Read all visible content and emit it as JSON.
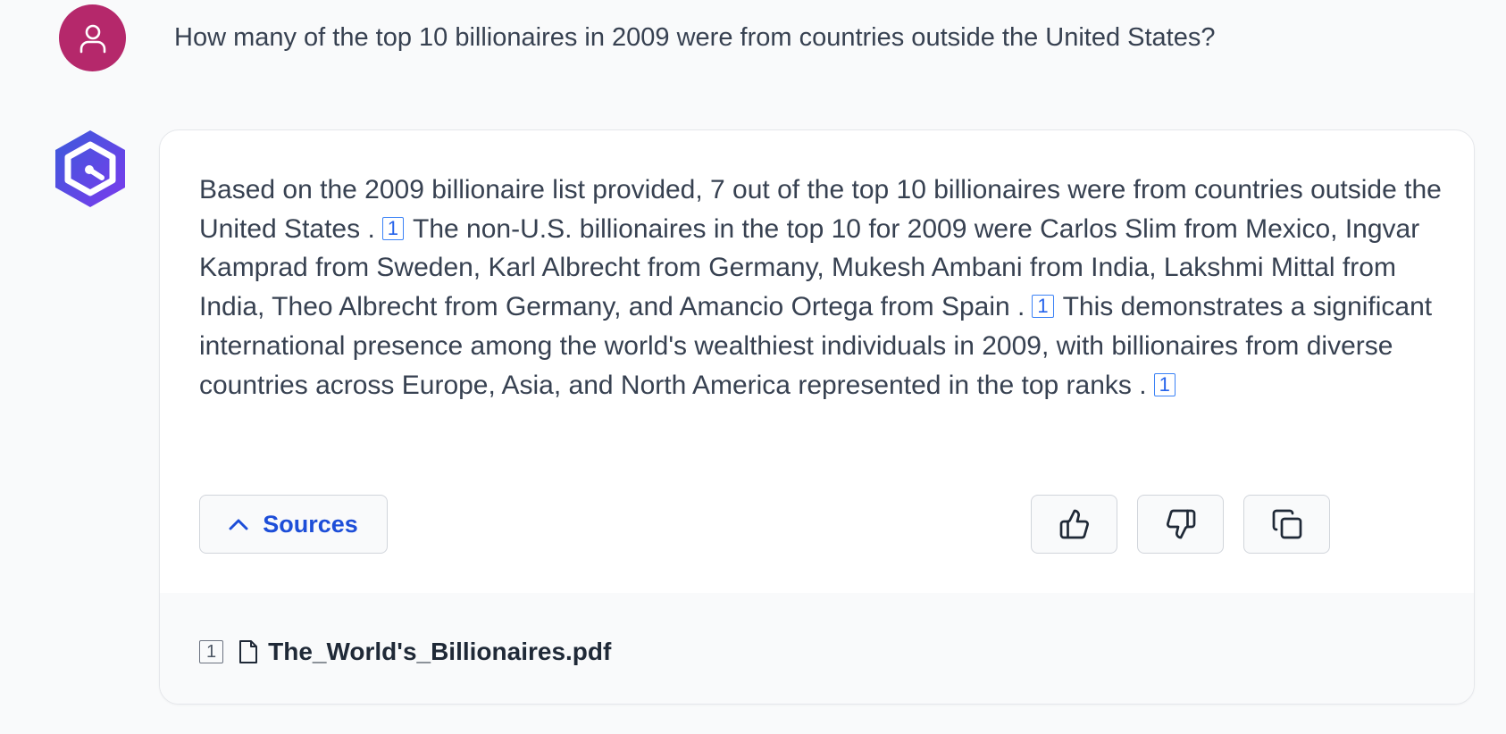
{
  "conversation": {
    "user_question": "How many of the top 10 billionaires in 2009 were from countries outside the United States?",
    "answer": {
      "segments": [
        "Based on the 2009 billionaire list provided, 7 out of the top 10 billionaires were from countries outside the United States .",
        "The non-U.S. billionaires in the top 10 for 2009 were Carlos Slim from Mexico, Ingvar Kamprad from Sweden, Karl Albrecht from Germany, Mukesh Ambani from India, Lakshmi Mittal from India, Theo Albrecht from Germany, and Amancio Ortega from Spain .",
        "This demonstrates a significant international presence among the world's wealthiest individuals in 2009, with billionaires from diverse countries across Europe, Asia, and North America represented in the top ranks ."
      ],
      "citations": [
        "1",
        "1",
        "1"
      ]
    },
    "sources_toggle_label": "Sources",
    "sources": [
      {
        "number": "1",
        "name": "The_World's_Billionaires.pdf"
      }
    ]
  },
  "icons": {
    "user_avatar": "user-icon",
    "bot_avatar": "hexagon-logo-icon",
    "sources_toggle": "chevron-up-icon",
    "feedback_positive": "thumbs-up-icon",
    "feedback_negative": "thumbs-down-icon",
    "copy": "copy-icon",
    "source_file": "file-icon"
  },
  "colors": {
    "user_avatar": "#b5286b",
    "bot_avatar_start": "#3b5bdb",
    "bot_avatar_end": "#7c3aed",
    "link": "#1d4ed8",
    "citation": "#2563eb"
  }
}
